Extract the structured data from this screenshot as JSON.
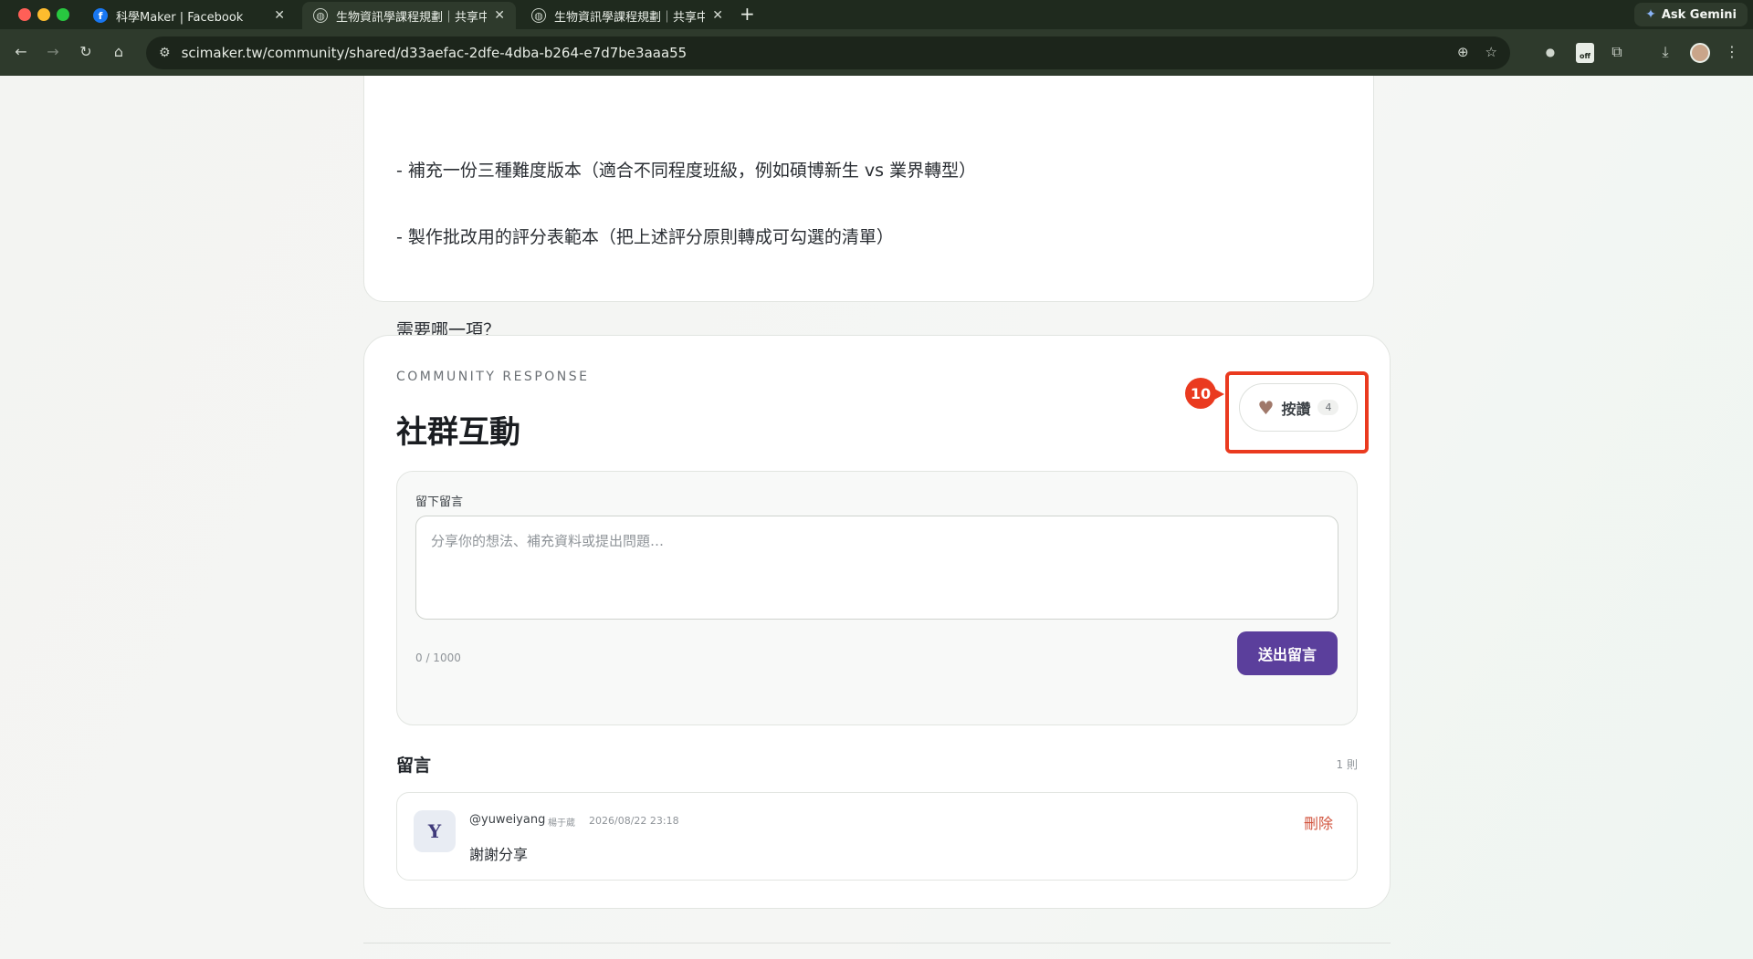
{
  "browser": {
    "tabs": [
      {
        "title": "科學Maker | Facebook",
        "active": false
      },
      {
        "title": "生物資訊學課程規劃｜共享中心",
        "active": true
      },
      {
        "title": "生物資訊學課程規劃｜共享中心",
        "active": false
      }
    ],
    "new_tab_label": "+",
    "close_label": "✕",
    "gemini_label": "Ask Gemini",
    "url": "scimaker.tw/community/shared/d33aefac-2dfe-4dba-b264-e7d7be3aaa55",
    "extension_badge": "off"
  },
  "content": {
    "paragraphs": [
      "- 補充一份三種難度版本（適合不同程度班級，例如碩博新生 vs 業界轉型）",
      "- 製作批改用的評分表範本（把上述評分原則轉成可勾選的清單）",
      "需要哪一項？"
    ]
  },
  "community": {
    "eyebrow": "COMMUNITY RESPONSE",
    "title": "社群互動",
    "like_label": "按讚",
    "like_count": "4",
    "annotation_number": "10",
    "form": {
      "label": "留下留言",
      "placeholder": "分享你的想法、補充資料或提出問題…",
      "value": "",
      "char_count": "0 / 1000",
      "submit_label": "送出留言"
    },
    "list_title": "留言",
    "list_count": "1 則",
    "comments": [
      {
        "avatar": "Y",
        "user": "@yuweiyang",
        "name": "楊于葳",
        "time": "2026/08/22 23:18",
        "text": "謝謝分享",
        "delete_label": "刪除"
      }
    ]
  },
  "colors": {
    "accent_purple": "#5b3f9c",
    "annotation_red": "#ea3a1f",
    "delete_red": "#d2553f",
    "heart": "#a0786a"
  }
}
